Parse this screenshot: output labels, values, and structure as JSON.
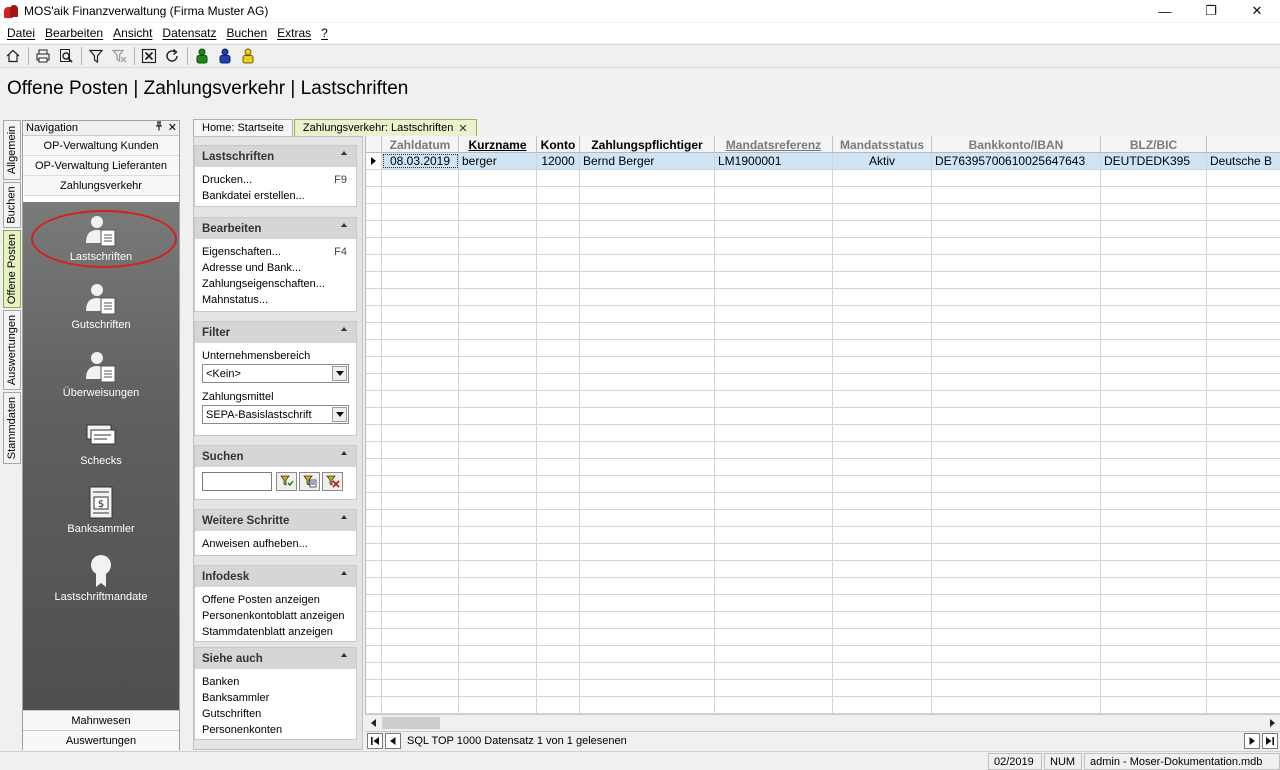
{
  "window": {
    "title": "MOS'aik Finanzverwaltung (Firma Muster AG)",
    "controls": {
      "minimize": "—",
      "maximize": "❐",
      "close": "✕"
    }
  },
  "menu": [
    "Datei",
    "Bearbeiten",
    "Ansicht",
    "Datensatz",
    "Buchen",
    "Extras",
    "?"
  ],
  "page_title": "Offene Posten | Zahlungsverkehr | Lastschriften",
  "vertical_tabs": [
    {
      "label": "Allgemein",
      "active": false
    },
    {
      "label": "Buchen",
      "active": false
    },
    {
      "label": "Offene Posten",
      "active": true
    },
    {
      "label": "Auswertungen",
      "active": false
    },
    {
      "label": "Stammdaten",
      "active": false
    }
  ],
  "navigation": {
    "header": "Navigation",
    "pin": "📌",
    "close": "✕",
    "links": [
      "OP-Verwaltung Kunden",
      "OP-Verwaltung Lieferanten",
      "Zahlungsverkehr"
    ],
    "items": [
      {
        "label": "Lastschriften",
        "icon": "person-document-icon"
      },
      {
        "label": "Gutschriften",
        "icon": "person-document-icon"
      },
      {
        "label": "Überweisungen",
        "icon": "person-document-icon"
      },
      {
        "label": "Schecks",
        "icon": "cheque-icon"
      },
      {
        "label": "Banksammler",
        "icon": "dollar-document-icon"
      },
      {
        "label": "Lastschriftmandate",
        "icon": "award-ribbon-icon"
      }
    ],
    "bottom": [
      "Mahnwesen",
      "Auswertungen"
    ]
  },
  "doc_tabs": [
    {
      "label": "Home: Startseite",
      "active": false
    },
    {
      "label": "Zahlungsverkehr: Lastschriften",
      "active": true,
      "close": "✕"
    }
  ],
  "task_panel": {
    "lastschriften": {
      "title": "Lastschriften",
      "items": [
        {
          "label": "Drucken...",
          "key": "F9"
        },
        {
          "label": "Bankdatei erstellen...",
          "key": ""
        }
      ]
    },
    "bearbeiten": {
      "title": "Bearbeiten",
      "items": [
        {
          "label": "Eigenschaften...",
          "key": "F4"
        },
        {
          "label": "Adresse und Bank...",
          "key": ""
        },
        {
          "label": "Zahlungseigenschaften...",
          "key": ""
        },
        {
          "label": "Mahnstatus...",
          "key": ""
        }
      ]
    },
    "filter": {
      "title": "Filter",
      "bereich_label": "Unternehmensbereich",
      "bereich_value": "<Kein>",
      "mittel_label": "Zahlungsmittel",
      "mittel_value": "SEPA-Basislastschrift"
    },
    "suchen": {
      "title": "Suchen",
      "value": ""
    },
    "weitere": {
      "title": "Weitere Schritte",
      "items": [
        "Anweisen aufheben..."
      ]
    },
    "infodesk": {
      "title": "Infodesk",
      "items": [
        "Offene Posten anzeigen",
        "Personenkontoblatt anzeigen",
        "Stammdatenblatt anzeigen"
      ]
    },
    "siehe": {
      "title": "Siehe auch",
      "items": [
        "Banken",
        "Banksammler",
        "Gutschriften",
        "Personenkonten"
      ]
    }
  },
  "grid": {
    "columns": [
      {
        "label": "Zahldatum",
        "style": "muted"
      },
      {
        "label": "Kurzname",
        "style": "ul"
      },
      {
        "label": "Konto",
        "style": ""
      },
      {
        "label": "Zahlungspflichtiger",
        "style": ""
      },
      {
        "label": "Mandatsreferenz",
        "style": "muted ul"
      },
      {
        "label": "Mandatsstatus",
        "style": "muted"
      },
      {
        "label": "Bankkonto/IBAN",
        "style": "muted"
      },
      {
        "label": "BLZ/BIC",
        "style": "muted"
      },
      {
        "label": "",
        "style": ""
      }
    ],
    "rows": [
      [
        "08.03.2019",
        "berger",
        "12000",
        "Bernd Berger",
        "LM1900001",
        "Aktiv",
        "DE76395700610025647643",
        "DEUTDEDK395",
        "Deutsche B"
      ]
    ]
  },
  "record_nav": {
    "text": "SQL TOP 1000 Datensatz 1 von 1 gelesenen"
  },
  "status": {
    "period": "02/2019",
    "num": "NUM",
    "user": "admin - Moser-Dokumentation.mdb"
  }
}
